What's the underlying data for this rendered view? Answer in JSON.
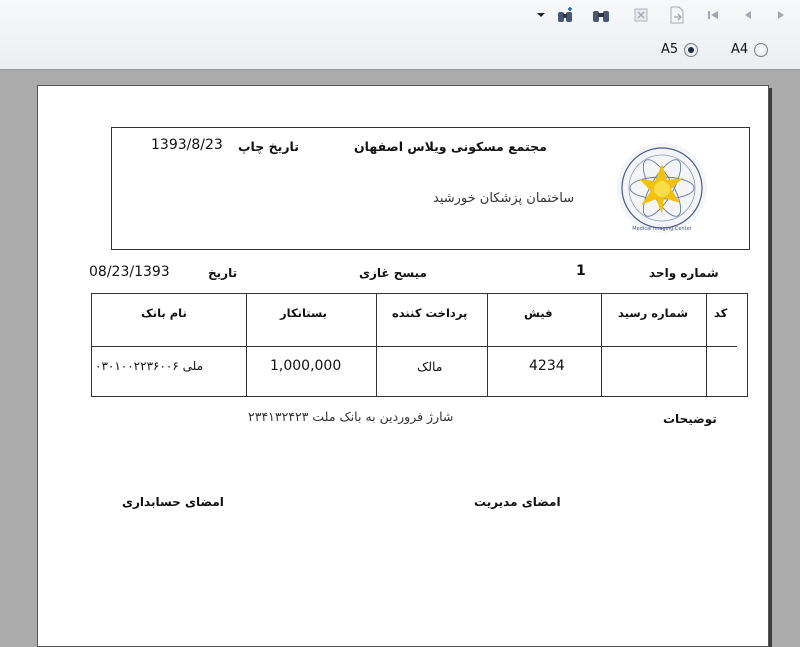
{
  "toolbar": {
    "page_sizes": [
      {
        "label": "A5",
        "selected": true
      },
      {
        "label": "A4",
        "selected": false
      }
    ]
  },
  "receipt": {
    "complex_name": "مجتمع مسکونی ویلاس اصفهان",
    "print_date_label": "تاریخ چاپ",
    "print_date": "1393/8/23",
    "building_name": "ساختمان پزشکان خورشید",
    "logo_caption": "Medical Imaging Center",
    "unit_label": "شماره واحد",
    "unit_value": "1",
    "owner_name": "میسح  غازی",
    "date_label": "تاریخ",
    "date_value": "08/23/1393",
    "table": {
      "headers": [
        "کد",
        "شماره رسید",
        "فیش",
        "پرداخت کننده",
        "بستانکار",
        "نام بانک"
      ],
      "row": [
        "",
        "",
        "4234",
        "مالک",
        "1,000,000",
        "ملی ۰۳۰۱۰۰۲۲۳۶۰۰۶"
      ]
    },
    "notes_label": "توضیحات",
    "notes_text": "شارژ فروردین به بانک ملت ۲۳۴۱۳۲۴۲۳",
    "management_signature": "امضای مدیریت",
    "accounting_signature": "امضای حسابداری"
  }
}
